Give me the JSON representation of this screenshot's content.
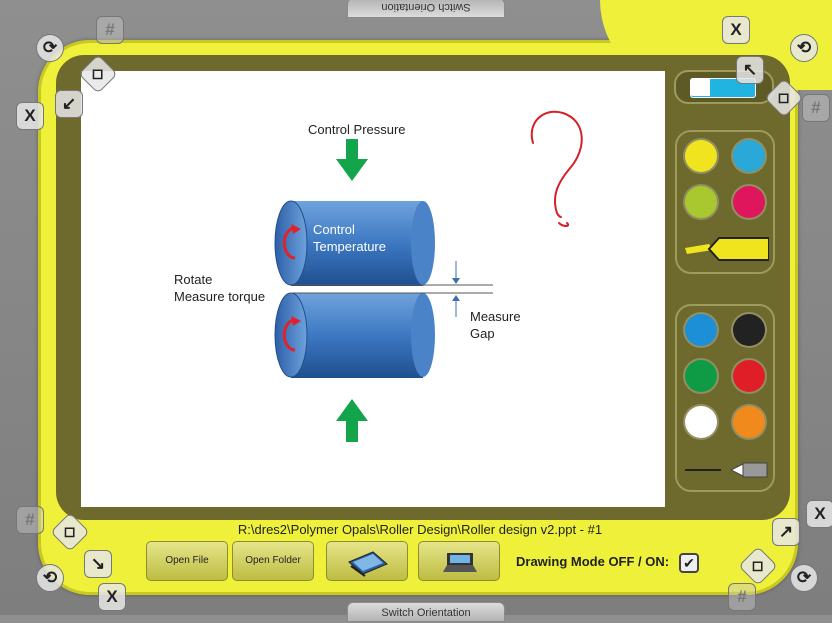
{
  "switch_top_label": "Switch Orientation",
  "switch_bottom_label": "Switch Orientation",
  "slide": {
    "title": "Control Pressure",
    "roller_label": "Control\nTemperature",
    "left_label": "Rotate\nMeasure torque",
    "gap_label": "Measure\nGap"
  },
  "palette": {
    "highlighter_colors": [
      "#f0e41e",
      "#2aa8d8",
      "#a9c830",
      "#e0165c"
    ],
    "pen_colors": [
      "#1d8fd6",
      "#222222",
      "#0f9b45",
      "#e01e28",
      "#ffffff",
      "#f08a1c"
    ]
  },
  "bottom": {
    "file_path": "R:\\dres2\\Polymer Opals\\Roller Design\\Roller design v2.ppt - #1",
    "open_file": "Open File",
    "open_folder": "Open Folder",
    "drawing_mode": "Drawing Mode OFF / ON:",
    "drawing_mode_checked": true
  },
  "corners": {
    "close": "X",
    "grid": "#"
  }
}
